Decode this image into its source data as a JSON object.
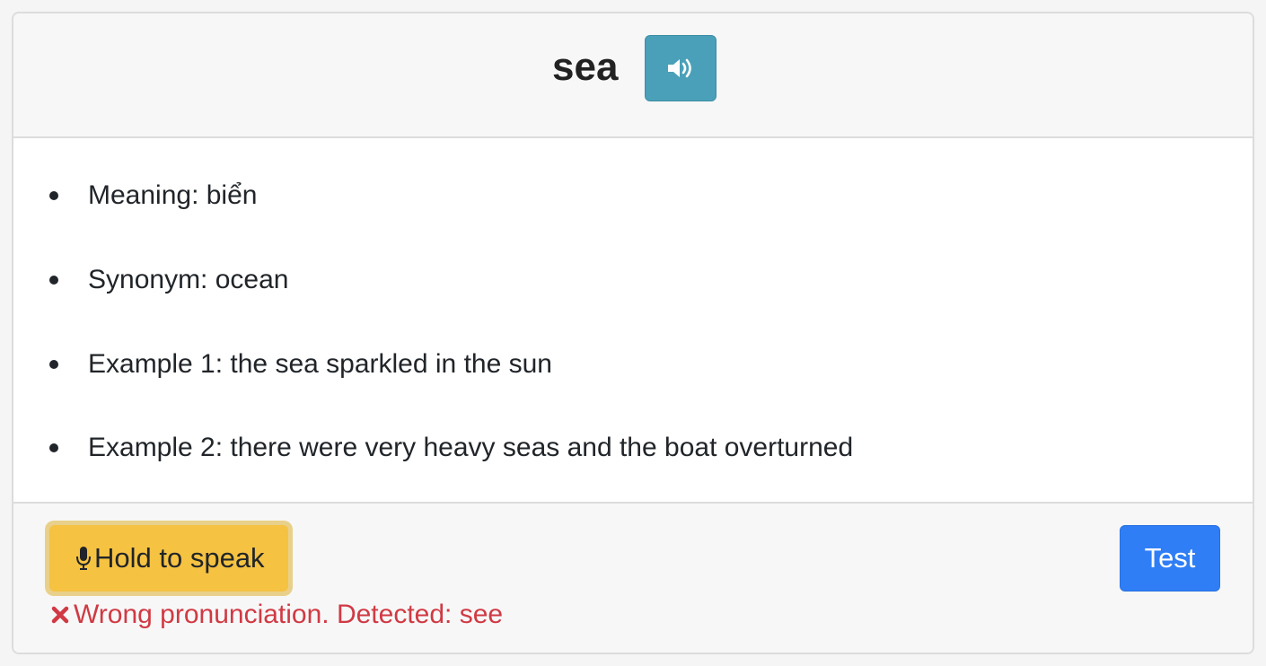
{
  "word": "sea",
  "icons": {
    "sound": "volume-up-icon",
    "mic": "microphone-icon",
    "error": "x-mark-icon"
  },
  "details": [
    {
      "text": "Meaning: biển"
    },
    {
      "text": "Synonym: ocean"
    },
    {
      "text": "Example 1: the sea sparkled in the sun"
    },
    {
      "text": "Example 2: there were very heavy seas and the boat overturned"
    }
  ],
  "footer": {
    "speak_label": "Hold to speak",
    "result_message": "Wrong pronunciation. Detected: see",
    "test_label": "Test"
  },
  "colors": {
    "sound_button": "#4aa0b8",
    "speak_button": "#f5c242",
    "test_button": "#2f7ef6",
    "error_text": "#d03a44"
  }
}
